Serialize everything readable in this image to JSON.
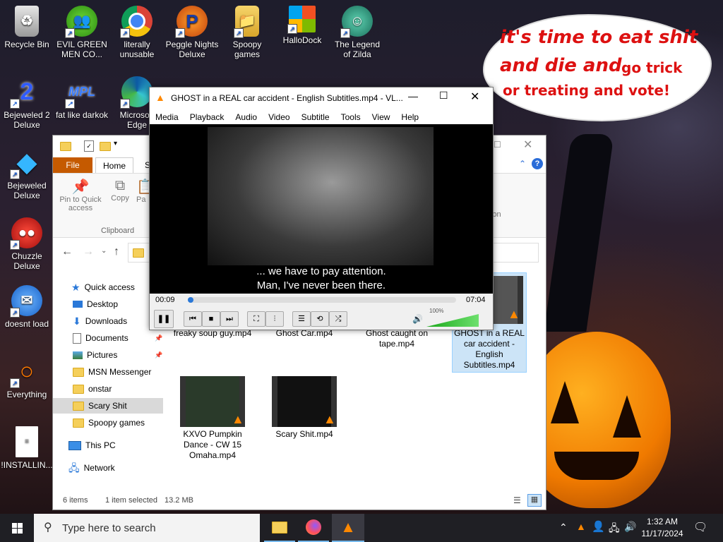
{
  "desktop": {
    "icons": [
      {
        "label": "Recycle Bin"
      },
      {
        "label": "EVIL GREEN MEN CO..."
      },
      {
        "label": "literally unusable"
      },
      {
        "label": "Peggle Nights Deluxe"
      },
      {
        "label": "Spoopy games"
      },
      {
        "label": "HalloDock"
      },
      {
        "label": "The Legend of Zilda"
      },
      {
        "label": "Bejeweled 2 Deluxe"
      },
      {
        "label": "fat like darkok"
      },
      {
        "label": "Microsoft Edge"
      },
      {
        "label": "Bejeweled Deluxe"
      },
      {
        "label": "Chuzzle Deluxe"
      },
      {
        "label": "doesnt load"
      },
      {
        "label": "Everything"
      },
      {
        "label": "!INSTALLIN..."
      }
    ],
    "bubble": {
      "line1": "it's time to eat shit",
      "line2a": "and die and",
      "line2b": "go trick",
      "line3": "or treating and vote!"
    }
  },
  "explorer": {
    "ribbon": {
      "tab_file": "File",
      "tab_home": "Home",
      "tab_share": "S",
      "pin_label": "Pin to Quick access",
      "copy_label": "Copy",
      "paste_label": "Pa",
      "group_clipboard": "Clipboard",
      "ion_partial": "ion"
    },
    "nav": {
      "quick_access": "Quick access",
      "items": [
        "Desktop",
        "Downloads",
        "Documents",
        "Pictures",
        "MSN Messenger",
        "onstar",
        "Scary Shit",
        "Spoopy games"
      ],
      "this_pc": "This PC",
      "network": "Network"
    },
    "files": [
      {
        "name": "freaky soup guy.mp4"
      },
      {
        "name": "Ghost Car.mp4"
      },
      {
        "name": "Ghost caught on tape.mp4"
      },
      {
        "name": "GHOST in a REAL car accident - English Subtitles.mp4"
      },
      {
        "name": "KXVO Pumpkin Dance - CW 15 Omaha.mp4"
      },
      {
        "name": "Scary Shit.mp4"
      }
    ],
    "status": {
      "items": "6 items",
      "selected": "1 item selected",
      "size": "13.2 MB"
    }
  },
  "vlc": {
    "title": "GHOST in a REAL car accident - English Subtitles.mp4 - VL...",
    "menu": [
      "Media",
      "Playback",
      "Audio",
      "Video",
      "Subtitle",
      "Tools",
      "View",
      "Help"
    ],
    "subtitle_line1": "... we have to pay attention.",
    "subtitle_line2": "Man, I've never been there.",
    "elapsed": "00:09",
    "total": "07:04",
    "progress_fraction": 0.021,
    "volume_label": "100%",
    "volume_fraction": 1.0
  },
  "taskbar": {
    "search_placeholder": "Type here to search",
    "time": "1:32 AM",
    "date": "11/17/2024"
  }
}
